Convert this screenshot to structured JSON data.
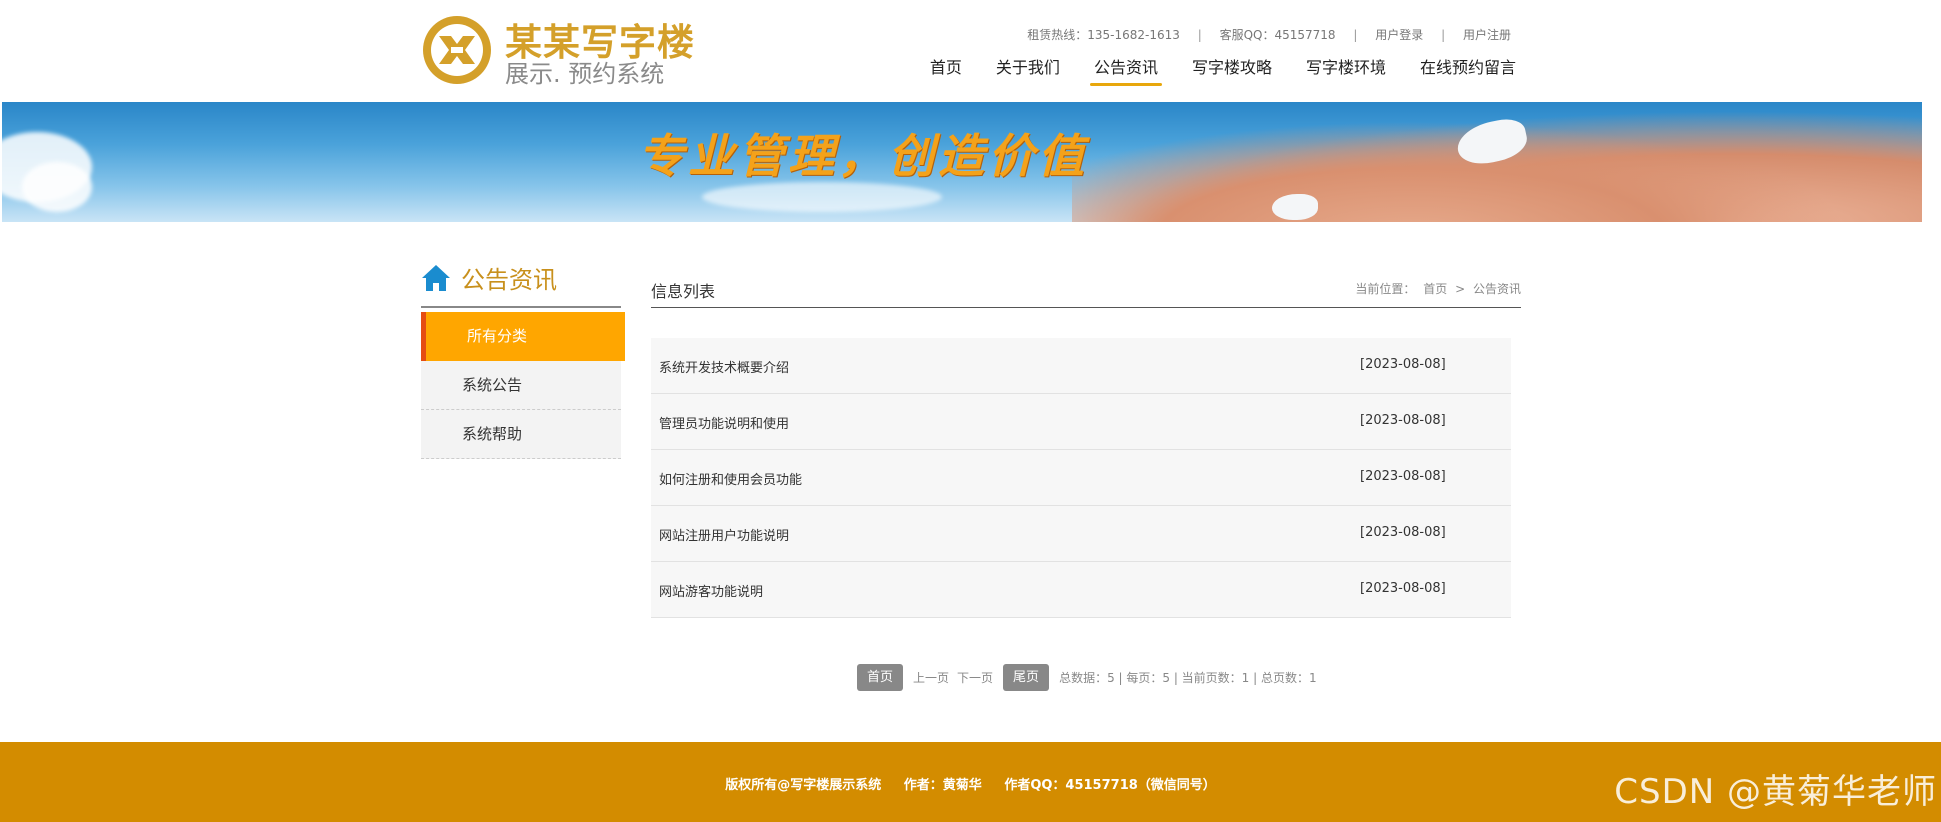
{
  "brand": {
    "title": "某某写字楼",
    "subtitle": "展示. 预约系统",
    "color": "#d4a02a"
  },
  "topbar": {
    "hotline": "租赁热线：135-1682-1613",
    "qq": "客服QQ：45157718",
    "login": "用户登录",
    "register": "用户注册",
    "separator": "|"
  },
  "nav": {
    "items": [
      {
        "label": "首页"
      },
      {
        "label": "关于我们"
      },
      {
        "label": "公告资讯",
        "active": true
      },
      {
        "label": "写字楼攻略"
      },
      {
        "label": "写字楼环境"
      },
      {
        "label": "在线预约留言"
      }
    ],
    "accent": "#e8a70c"
  },
  "banner": {
    "slogan": "专业管理，创造价值"
  },
  "sidebar": {
    "title": "公告资讯",
    "categories": [
      {
        "label": "所有分类",
        "active": true
      },
      {
        "label": "系统公告"
      },
      {
        "label": "系统帮助"
      }
    ],
    "active_color": "#ffa600"
  },
  "main": {
    "title": "信息列表",
    "breadcrumb": {
      "prefix": "当前位置：",
      "home": "首页",
      "sep": ">",
      "current": "公告资讯"
    },
    "rows": [
      {
        "title": "系统开发技术概要介绍",
        "date": "[2023-08-08]"
      },
      {
        "title": "管理员功能说明和使用",
        "date": "[2023-08-08]"
      },
      {
        "title": "如何注册和使用会员功能",
        "date": "[2023-08-08]"
      },
      {
        "title": "网站注册用户功能说明",
        "date": "[2023-08-08]"
      },
      {
        "title": "网站游客功能说明",
        "date": "[2023-08-08]"
      }
    ]
  },
  "pager": {
    "first": "首页",
    "prev": "上一页",
    "next": "下一页",
    "last": "尾页",
    "info": "总数据：5 | 每页：5 | 当前页数：1 | 总页数：1"
  },
  "footer": {
    "copyright": "版权所有@写字楼展示系统",
    "author": "作者：黄菊华",
    "contact": "作者QQ：45157718（微信同号）",
    "color": "#d38c00"
  },
  "watermark": "CSDN @黄菊华老师"
}
